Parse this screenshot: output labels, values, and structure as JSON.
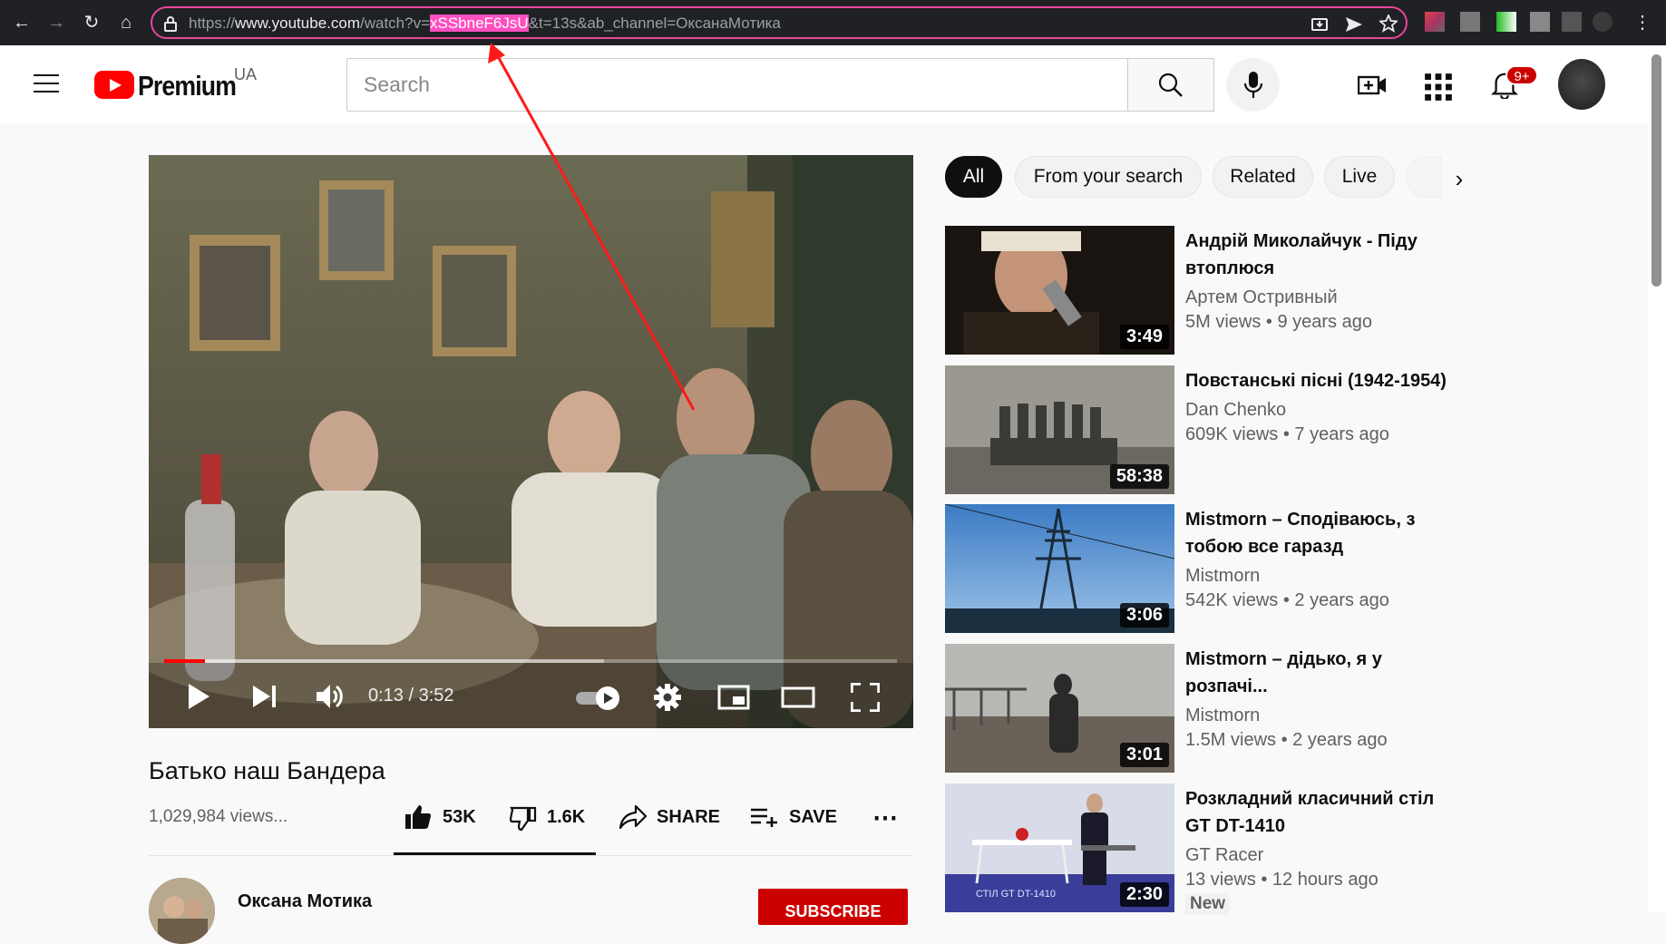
{
  "browser": {
    "url_prefix": "https://",
    "url_host": "www.youtube.com",
    "url_path": "/watch?v=",
    "url_video_id": "xSSbneF6JsU",
    "url_suffix": "&t=13s&ab_channel=ОксанаМотика",
    "nav_icons": [
      "back-icon",
      "forward-icon",
      "reload-icon",
      "home-icon"
    ],
    "url_icons": [
      "lock-icon",
      "install-icon",
      "send-icon",
      "star-icon"
    ]
  },
  "header": {
    "logo_text": "Premium",
    "region": "UA",
    "search_placeholder": "Search",
    "notification_count": "9+",
    "icons": [
      "menu-icon",
      "search-icon",
      "mic-icon",
      "create-icon",
      "apps-icon",
      "bell-icon"
    ]
  },
  "player": {
    "time": "0:13 / 3:52",
    "progress_fraction": 0.056,
    "buffer_fraction": 0.6,
    "accent_color": "#ff0000"
  },
  "video": {
    "title": "Батько наш Бандера",
    "views": "1,029,984 views...",
    "likes": "53K",
    "dislikes": "1.6K",
    "share_label": "SHARE",
    "save_label": "SAVE",
    "channel_name": "Оксана Мотика",
    "subscribe_label": "SUBSCRIBE"
  },
  "chips": [
    "All",
    "From your search",
    "Related",
    "Live"
  ],
  "related": [
    {
      "title": "Андрій Миколайчук - Піду втоплюся",
      "channel": "Артем Остривный",
      "meta": "5M views • 9 years ago",
      "duration": "3:49"
    },
    {
      "title": "Повстанські пісні (1942-1954)",
      "channel": "Dan Chenko",
      "meta": "609K views • 7 years ago",
      "duration": "58:38"
    },
    {
      "title": "Mistmorn – Сподіваюсь, з тобою все гаразд",
      "channel": "Mistmorn",
      "meta": "542K views • 2 years ago",
      "duration": "3:06"
    },
    {
      "title": "Mistmorn – дідько, я у розпачі...",
      "channel": "Mistmorn",
      "meta": "1.5M views • 2 years ago",
      "duration": "3:01"
    },
    {
      "title": "Розкладний класичний стіл GT DT-1410",
      "channel": "GT Racer",
      "meta": "13 views • 12 hours ago",
      "duration": "2:30",
      "badge": "New",
      "thumb_caption": "СТІЛ GT DT-1410"
    }
  ]
}
